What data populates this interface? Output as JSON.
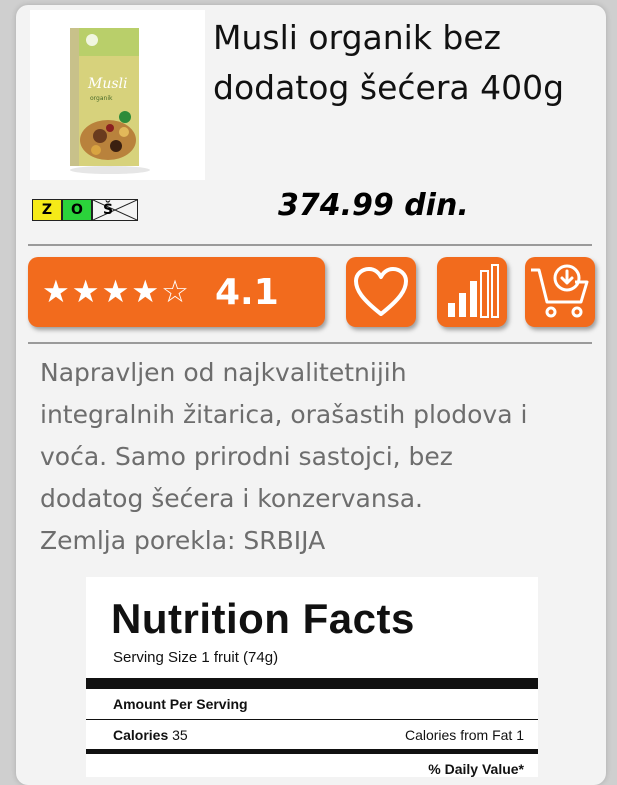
{
  "product": {
    "title_line1": "Musli organik bez",
    "title_line2": "dodatog šećera 400g",
    "price": "374.99 din.",
    "package_brand": "Musli",
    "package_sub": "organik"
  },
  "badges": [
    {
      "letter": "Z",
      "color": "#f5ea18"
    },
    {
      "letter": "O",
      "color": "#2bd33b"
    },
    {
      "letter": "Š",
      "color": "#f4f4f4",
      "crossed": true
    }
  ],
  "rating": {
    "stars_text": "★★★★☆",
    "value": "4.1",
    "stars_filled": 4,
    "stars_total": 5
  },
  "actions": {
    "favorite_icon": "heart-icon",
    "compare_icon": "signal-bars-icon",
    "cart_icon": "cart-download-icon"
  },
  "description": {
    "line1": "Napravljen od najkvalitetnijih",
    "line2": "integralnih žitarica, orašastih plodova i",
    "line3": "voća. Samo prirodni sastojci, bez",
    "line4": "dodatog šećera i konzervansa.",
    "origin": "Zemlja porekla: SRBIJA"
  },
  "nutrition": {
    "title": "Nutrition Facts",
    "serving": "Serving Size 1 fruit (74g)",
    "amount_label": "Amount Per Serving",
    "calories_label": "Calories",
    "calories_value": "35",
    "calories_fat": "Calories from Fat 1",
    "daily_value": "% Daily Value*"
  },
  "colors": {
    "accent": "#f26b1d",
    "description_text": "#6d6d6d"
  }
}
